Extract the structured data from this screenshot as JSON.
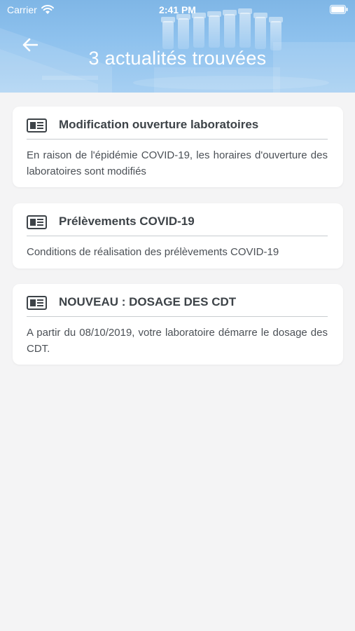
{
  "status_bar": {
    "carrier": "Carrier",
    "time": "2:41 PM"
  },
  "header": {
    "title": "3 actualités trouvées",
    "back_icon": "arrow-left-icon",
    "colors": {
      "gradient_top": "#7fb6e6",
      "gradient_bottom": "#a6cff2"
    }
  },
  "news": [
    {
      "title": "Modification ouverture laboratoires",
      "text": "En raison de l'épidémie COVID-19, les horaires d'ouverture des laboratoires sont modifiés",
      "icon": "newspaper-icon"
    },
    {
      "title": "Prélèvements COVID-19",
      "text": "Conditions de réalisation des prélèvements COVID-19",
      "icon": "newspaper-icon"
    },
    {
      "title": "NOUVEAU : DOSAGE DES CDT",
      "text": "A partir du 08/10/2019, votre laboratoire démarre le dosage des CDT.",
      "icon": "newspaper-icon"
    }
  ]
}
